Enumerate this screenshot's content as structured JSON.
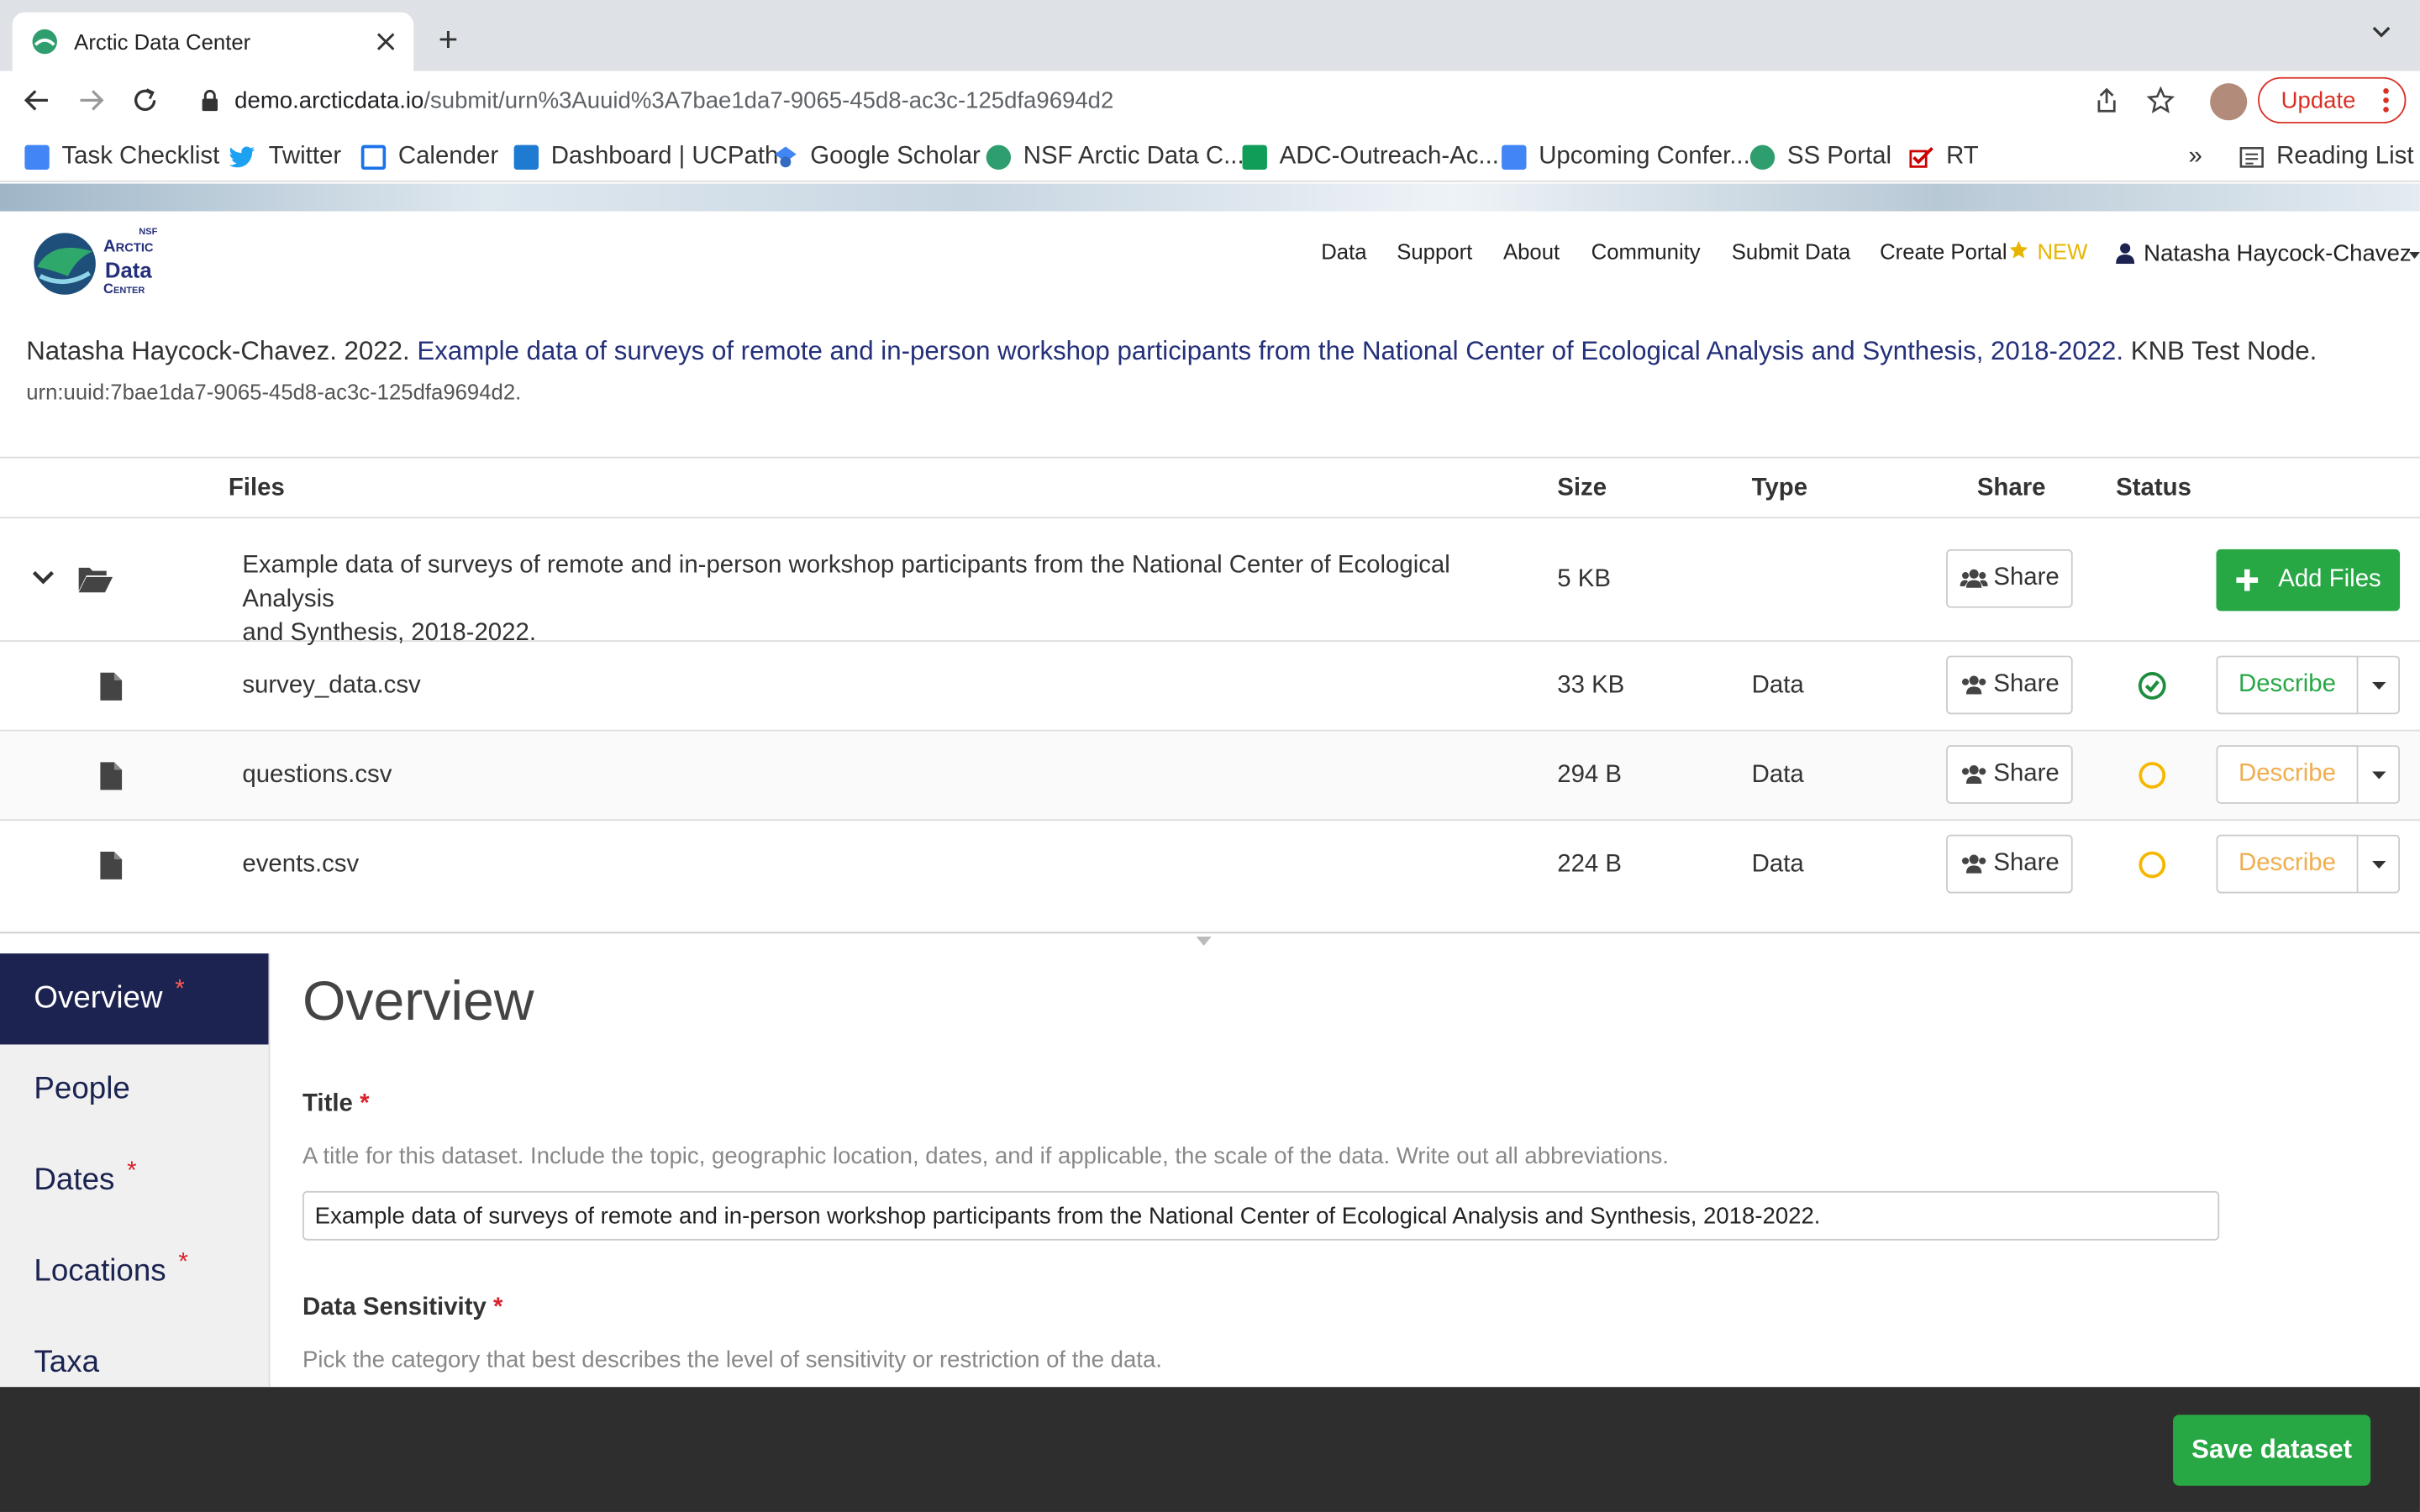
{
  "browser": {
    "tab_title": "Arctic Data Center",
    "url_host": "demo.arcticdata.io",
    "url_path": "/submit/urn%3Auuid%3A7bae1da7-9065-45d8-ac3c-125dfa9694d2",
    "update_label": "Update",
    "bookmarks": [
      "Task Checklist",
      "Twitter",
      "Calender",
      "Dashboard | UCPath",
      "Google Scholar",
      "NSF Arctic Data C...",
      "ADC-Outreach-Ac...",
      "Upcoming Confer...",
      "SS Portal",
      "RT"
    ],
    "overflow": "»",
    "reading_list": "Reading List"
  },
  "site": {
    "logo_nsf": "NSF",
    "logo_line1": "Arctic",
    "logo_line2": "Data",
    "logo_line3": "Center",
    "nav": [
      "Data",
      "Support",
      "About",
      "Community",
      "Submit Data",
      "Create Portal"
    ],
    "new_badge": "NEW",
    "user": "Natasha Haycock-Chavez"
  },
  "citation": {
    "author_year": "Natasha Haycock-Chavez. 2022.",
    "title": "Example data of surveys of remote and in-person workshop participants from the National Center of Ecological Analysis and Synthesis, 2018-2022.",
    "node": "KNB Test Node.",
    "urn": "urn:uuid:7bae1da7-9065-45d8-ac3c-125dfa9694d2."
  },
  "table": {
    "headers": {
      "files": "Files",
      "size": "Size",
      "type": "Type",
      "share": "Share",
      "status": "Status"
    },
    "package": {
      "name_line1": "Example data of surveys of remote and in-person workshop participants from the National Center of Ecological Analysis",
      "name_line2": "and Synthesis, 2018-2022.",
      "size": "5 KB",
      "share_label": "Share",
      "add_files_label": "Add Files"
    },
    "files": [
      {
        "name": "survey_data.csv",
        "size": "33 KB",
        "type": "Data",
        "share": "Share",
        "describe": "Describe",
        "status": "complete"
      },
      {
        "name": "questions.csv",
        "size": "294 B",
        "type": "Data",
        "share": "Share",
        "describe": "Describe",
        "status": "pending"
      },
      {
        "name": "events.csv",
        "size": "224 B",
        "type": "Data",
        "share": "Share",
        "describe": "Describe",
        "status": "pending"
      }
    ]
  },
  "sidebar": {
    "items": [
      {
        "label": "Overview",
        "required": "*"
      },
      {
        "label": "People",
        "required": ""
      },
      {
        "label": "Dates",
        "required": "*"
      },
      {
        "label": "Locations",
        "required": "*"
      },
      {
        "label": "Taxa",
        "required": ""
      }
    ]
  },
  "overview": {
    "heading": "Overview",
    "title_label": "Title",
    "title_required": "*",
    "title_help": "A title for this dataset. Include the topic, geographic location, dates, and if applicable, the scale of the data. Write out all abbreviations.",
    "title_value": "Example data of surveys of remote and in-person workshop participants from the National Center of Ecological Analysis and Synthesis, 2018-2022.",
    "sensitivity_label": "Data Sensitivity",
    "sensitivity_required": "*",
    "sensitivity_help": "Pick the category that best describes the level of sensitivity or restriction of the data."
  },
  "footer": {
    "save_label": "Save dataset"
  },
  "colors": {
    "accent_green": "#28a745",
    "navy": "#1d2350",
    "describe_green": "#28a745",
    "describe_orange": "#f0ad4e",
    "link": "#24307a"
  }
}
